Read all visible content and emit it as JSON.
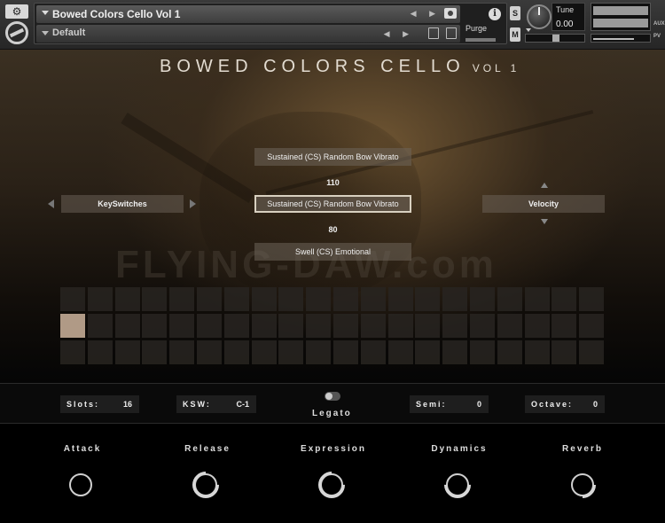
{
  "header": {
    "instrument_name": "Bowed Colors Cello Vol 1",
    "snapshot_name": "Default",
    "purge_label": "Purge",
    "tune_label": "Tune",
    "tune_value": "0.00",
    "solo_label": "S",
    "mute_label": "M",
    "aux_label": "AUX",
    "pv_label": "PV",
    "info_label": "i",
    "nav_arrows": "◀ ▶"
  },
  "panel": {
    "title": "BOWED COLORS CELLO",
    "title_vol": "VOL 1",
    "watermark": "FLYING-DAW.com",
    "articulation_prev": "Sustained (CS) Random Bow Vibrato",
    "articulation_selected": "Sustained (CS) Random Bow Vibrato",
    "articulation_next": "Swell (CS) Emotional",
    "value_upper": "110",
    "value_lower": "80",
    "left_menu": "KeySwitches",
    "right_menu": "Velocity",
    "slot_rows": 3,
    "slot_cols": 20,
    "active_slot": {
      "row": 1,
      "col": 0
    }
  },
  "settings": {
    "slots_label": "Slots:",
    "slots_value": "16",
    "ksw_label": "KSW:",
    "ksw_value": "C-1",
    "legato_label": "Legato",
    "semi_label": "Semi:",
    "semi_value": "0",
    "octave_label": "Octave:",
    "octave_value": "0"
  },
  "knobs": [
    {
      "label": "Attack",
      "value": 0.0
    },
    {
      "label": "Release",
      "value": 0.75
    },
    {
      "label": "Expression",
      "value": 0.7
    },
    {
      "label": "Dynamics",
      "value": 0.55
    },
    {
      "label": "Reverb",
      "value": 0.35
    }
  ]
}
